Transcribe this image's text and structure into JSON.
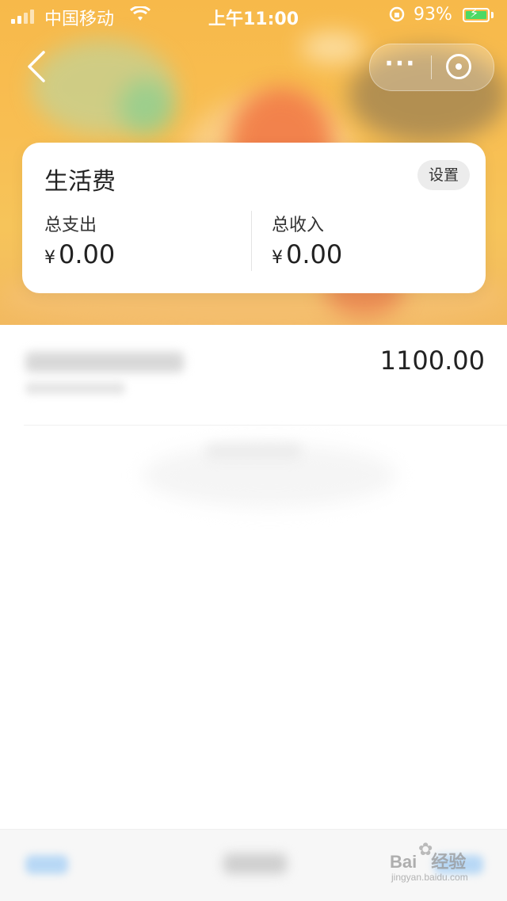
{
  "status_bar": {
    "carrier": "中国移动",
    "time": "上午11:00",
    "battery_percent": "93%",
    "battery_level": 0.93,
    "icons": [
      "signal-icon",
      "wifi-icon",
      "orientation-lock-icon",
      "battery-charging-icon"
    ]
  },
  "nav": {
    "back_icon": "chevron-left-icon",
    "more_icon": "more-dots-icon",
    "close_icon": "miniprogram-close-icon"
  },
  "summary": {
    "title": "生活费",
    "settings_label": "设置",
    "expense_label": "总支出",
    "expense_value": "0.00",
    "income_label": "总收入",
    "income_value": "0.00",
    "currency_symbol": "¥"
  },
  "transactions": [
    {
      "amount": "1100.00"
    }
  ],
  "watermark": {
    "brand": "Bai",
    "brand_suffix": "经验",
    "url": "jingyan.baidu.com"
  },
  "colors": {
    "hero_orange": "#f7b94a",
    "battery_green": "#4cd964",
    "text_dark": "#222222"
  }
}
